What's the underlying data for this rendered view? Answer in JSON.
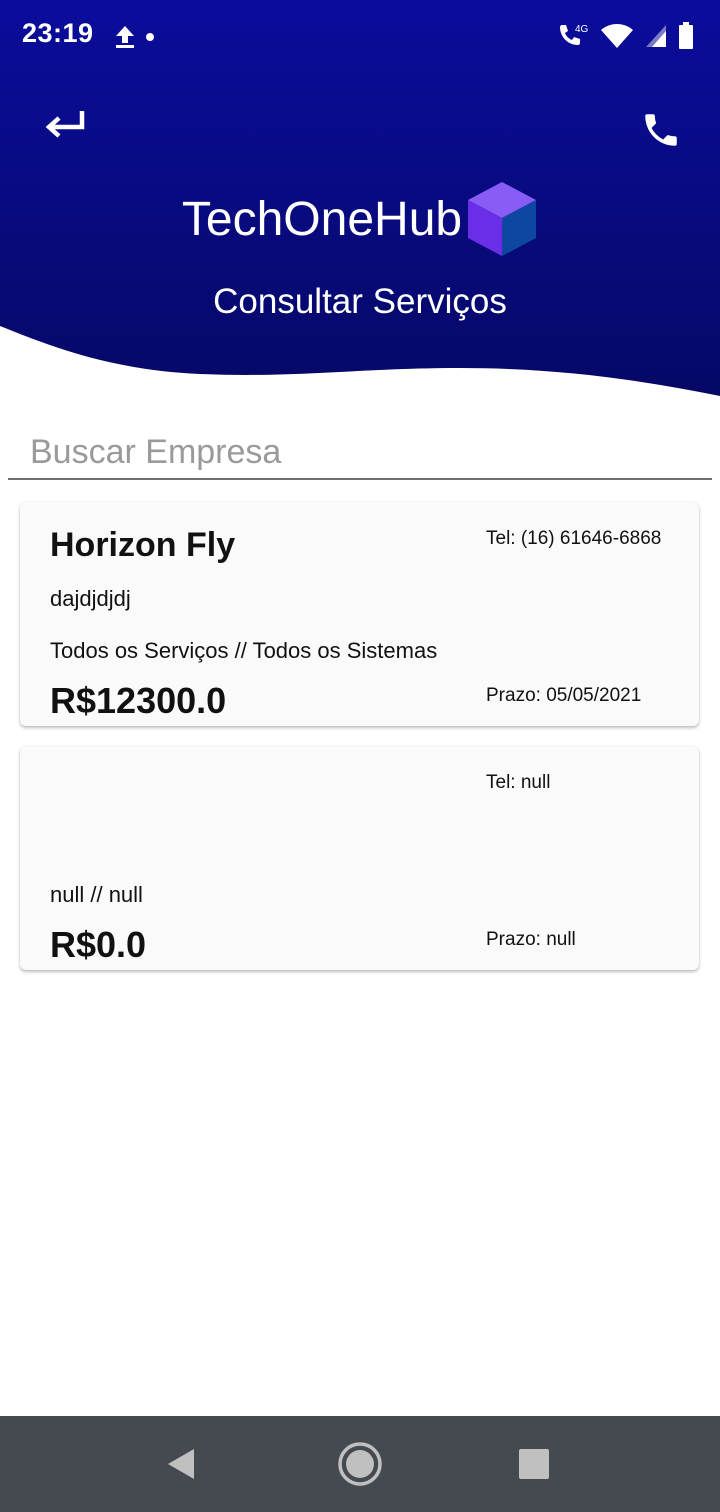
{
  "status_bar": {
    "time": "23:19",
    "network_label": "4G",
    "icons": [
      "upload-icon",
      "notification-dot-icon",
      "wifi-call-icon",
      "wifi-icon",
      "signal-icon",
      "battery-icon"
    ]
  },
  "header": {
    "brand": "TechOneHub",
    "subtitle": "Consultar Serviços",
    "back_icon": "return-arrow-icon",
    "call_icon": "phone-icon",
    "colors": {
      "gradient_top": "#0a0d9c",
      "gradient_bottom": "#060866",
      "cube_top": "#8a5cf6",
      "cube_left": "#6a2ee8",
      "cube_right": "#0d47a1"
    }
  },
  "search": {
    "placeholder": "Buscar Empresa",
    "value": ""
  },
  "services": [
    {
      "name": "Horizon Fly",
      "tel": "Tel: (16) 61646-6868",
      "description": "dajdjdjdj",
      "services": "Todos os Serviços // Todos os Sistemas",
      "price": "R$12300.0",
      "deadline": "Prazo: 05/05/2021"
    },
    {
      "name": "",
      "tel": "Tel: null",
      "description": "",
      "services": "null // null",
      "price": "R$0.0",
      "deadline": "Prazo: null"
    }
  ],
  "nav_bar": {
    "icons": [
      "back-triangle-icon",
      "home-circle-icon",
      "recents-square-icon"
    ],
    "color": "#444a50"
  }
}
